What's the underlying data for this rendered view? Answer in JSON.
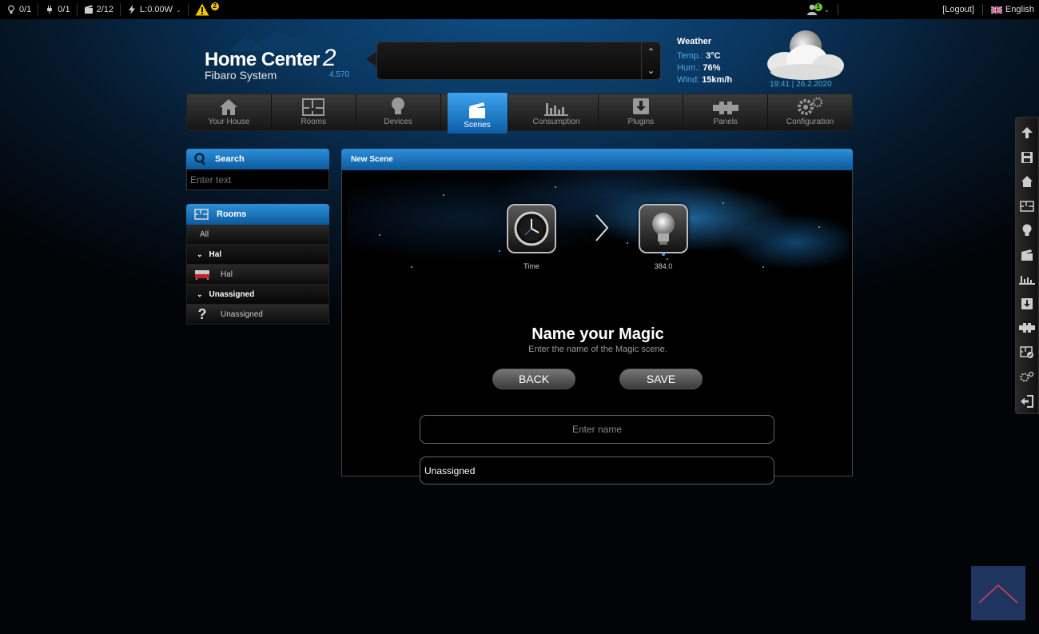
{
  "topbar": {
    "lights": "0/1",
    "plugs": "0/1",
    "scenes_active": "2/12",
    "power": "L:0.00W",
    "warnings_count": "2",
    "user_count": "1",
    "logout": "[Logout]",
    "language": "English"
  },
  "header": {
    "logo_title": "Home Center",
    "logo_number": "2",
    "logo_subtitle": "Fibaro System",
    "version": "4.570"
  },
  "weather": {
    "title": "Weather",
    "temp_label": "Temp.:",
    "temp_value": "3°C",
    "hum_label": "Hum.:",
    "hum_value": "76%",
    "wind_label": "Wind:",
    "wind_value": "15km/h",
    "datetime": "19:41 | 26.2.2020"
  },
  "nav": {
    "items": [
      {
        "label": "Your House"
      },
      {
        "label": "Rooms"
      },
      {
        "label": "Devices"
      },
      {
        "label": "Scenes"
      },
      {
        "label": "Consumption"
      },
      {
        "label": "Plugins"
      },
      {
        "label": "Panels"
      },
      {
        "label": "Configuration"
      }
    ]
  },
  "search": {
    "title": "Search",
    "placeholder": "Enter text"
  },
  "rooms": {
    "title": "Rooms",
    "all": "All",
    "groups": [
      {
        "name": "Hal",
        "room": "Hal"
      },
      {
        "name": "Unassigned",
        "room": "Unassigned"
      }
    ]
  },
  "main": {
    "header": "New Scene",
    "step1_label": "Time",
    "step2_label": "384.0",
    "title": "Name your Magic",
    "subtitle": "Enter the name of the Magic scene.",
    "back_label": "BACK",
    "save_label": "SAVE",
    "name_placeholder": "Enter name",
    "room_value": "Unassigned"
  }
}
